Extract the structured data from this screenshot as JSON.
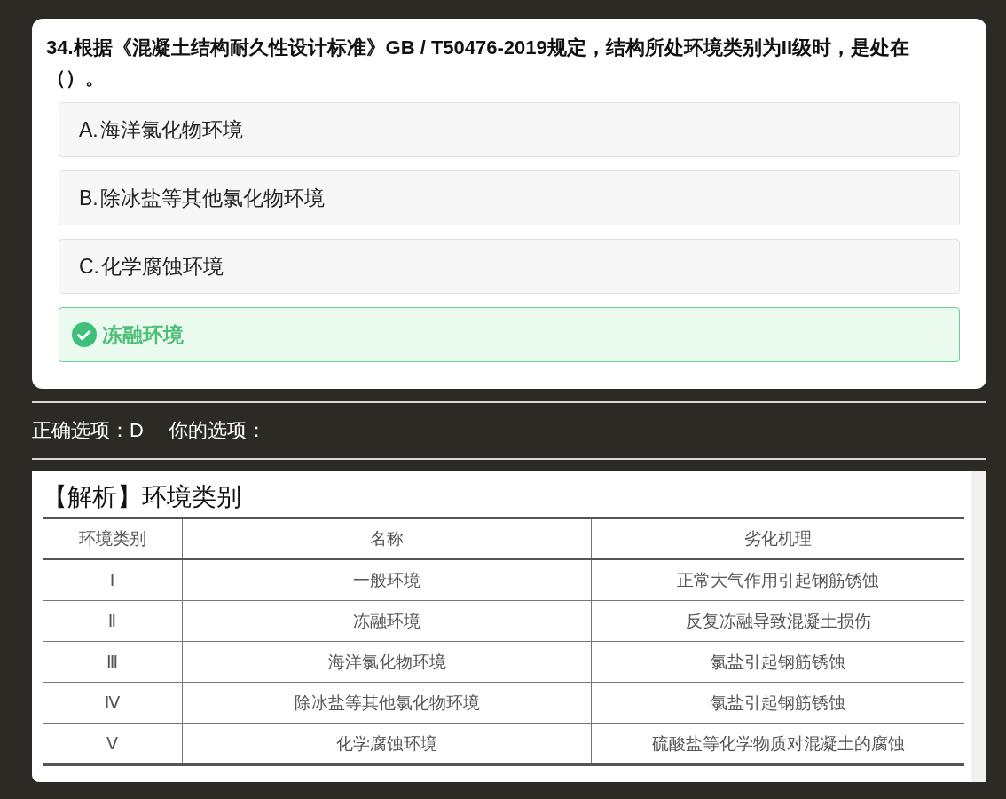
{
  "question": {
    "text": "34.根据《混凝土结构耐久性设计标准》GB / T50476-2019规定，结构所处环境类别为II级时，是处在（）。",
    "options": [
      {
        "label": "A.",
        "text": "海洋氯化物环境",
        "correct": false
      },
      {
        "label": "B.",
        "text": "除冰盐等其他氯化物环境",
        "correct": false
      },
      {
        "label": "C.",
        "text": "化学腐蚀环境",
        "correct": false
      },
      {
        "text": "冻融环境",
        "correct": true
      }
    ]
  },
  "answer": {
    "correct_label": "正确选项：D",
    "your_label": "你的选项："
  },
  "explanation": {
    "title": "【解析】环境类别",
    "table": {
      "columns": [
        "环境类别",
        "名称",
        "劣化机理"
      ],
      "rows": [
        [
          "Ⅰ",
          "一般环境",
          "正常大气作用引起钢筋锈蚀"
        ],
        [
          "Ⅱ",
          "冻融环境",
          "反复冻融导致混凝土损伤"
        ],
        [
          "Ⅲ",
          "海洋氯化物环境",
          "氯盐引起钢筋锈蚀"
        ],
        [
          "Ⅳ",
          "除冰盐等其他氯化物环境",
          "氯盐引起钢筋锈蚀"
        ],
        [
          "Ⅴ",
          "化学腐蚀环境",
          "硫酸盐等化学物质对混凝土的腐蚀"
        ]
      ]
    }
  }
}
